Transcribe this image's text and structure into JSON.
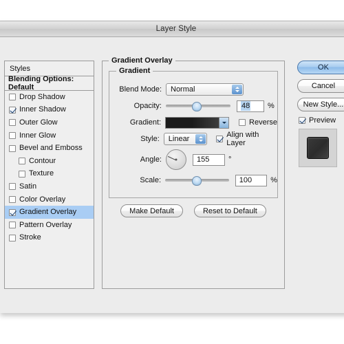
{
  "window": {
    "title": "Layer Style"
  },
  "styles_panel": {
    "header": "Styles",
    "blending_options": "Blending Options: Default",
    "effects": [
      {
        "label": "Drop Shadow",
        "checked": false,
        "indent": false,
        "selected": false
      },
      {
        "label": "Inner Shadow",
        "checked": true,
        "indent": false,
        "selected": false
      },
      {
        "label": "Outer Glow",
        "checked": false,
        "indent": false,
        "selected": false
      },
      {
        "label": "Inner Glow",
        "checked": false,
        "indent": false,
        "selected": false
      },
      {
        "label": "Bevel and Emboss",
        "checked": false,
        "indent": false,
        "selected": false
      },
      {
        "label": "Contour",
        "checked": false,
        "indent": true,
        "selected": false
      },
      {
        "label": "Texture",
        "checked": false,
        "indent": true,
        "selected": false
      },
      {
        "label": "Satin",
        "checked": false,
        "indent": false,
        "selected": false
      },
      {
        "label": "Color Overlay",
        "checked": false,
        "indent": false,
        "selected": false
      },
      {
        "label": "Gradient Overlay",
        "checked": true,
        "indent": false,
        "selected": true
      },
      {
        "label": "Pattern Overlay",
        "checked": false,
        "indent": false,
        "selected": false
      },
      {
        "label": "Stroke",
        "checked": false,
        "indent": false,
        "selected": false
      }
    ]
  },
  "gradient_overlay": {
    "group_title": "Gradient Overlay",
    "inner_group_title": "Gradient",
    "blend_mode": {
      "label": "Blend Mode:",
      "value": "Normal"
    },
    "opacity": {
      "label": "Opacity:",
      "value": "48",
      "unit": "%",
      "slider_percent": 48
    },
    "gradient": {
      "label": "Gradient:",
      "from_color": "#1b1b1b",
      "to_color": "#3d3d3d"
    },
    "reverse": {
      "label": "Reverse",
      "checked": false
    },
    "style": {
      "label": "Style:",
      "value": "Linear"
    },
    "align_with_layer": {
      "label": "Align with Layer",
      "checked": true
    },
    "angle": {
      "label": "Angle:",
      "value": "155",
      "unit": "°",
      "degrees": 155
    },
    "scale": {
      "label": "Scale:",
      "value": "100",
      "unit": "%",
      "slider_percent": 50
    },
    "make_default": "Make Default",
    "reset_to_default": "Reset to Default"
  },
  "actions": {
    "ok": "OK",
    "cancel": "Cancel",
    "new_style": "New Style...",
    "preview": {
      "label": "Preview",
      "checked": true
    }
  },
  "colors": {
    "accent": "#a9cdf4",
    "dialog_bg": "#ececec",
    "panel_bg": "#efefef"
  }
}
